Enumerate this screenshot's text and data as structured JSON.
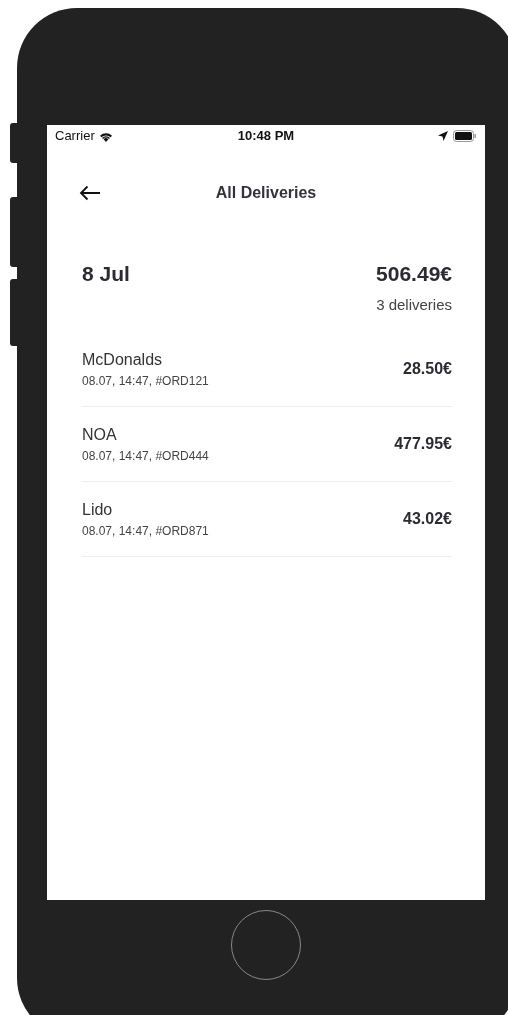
{
  "status_bar": {
    "carrier": "Carrier",
    "time": "10:48 PM"
  },
  "header": {
    "title": "All Deliveries"
  },
  "day": {
    "date": "8 Jul",
    "total": "506.49€",
    "count": "3 deliveries"
  },
  "deliveries": [
    {
      "name": "McDonalds",
      "details": "08.07, 14:47, #ORD121",
      "amount": "28.50€"
    },
    {
      "name": "NOA",
      "details": "08.07, 14:47, #ORD444",
      "amount": "477.95€"
    },
    {
      "name": "Lido",
      "details": "08.07, 14:47, #ORD871",
      "amount": "43.02€"
    }
  ]
}
